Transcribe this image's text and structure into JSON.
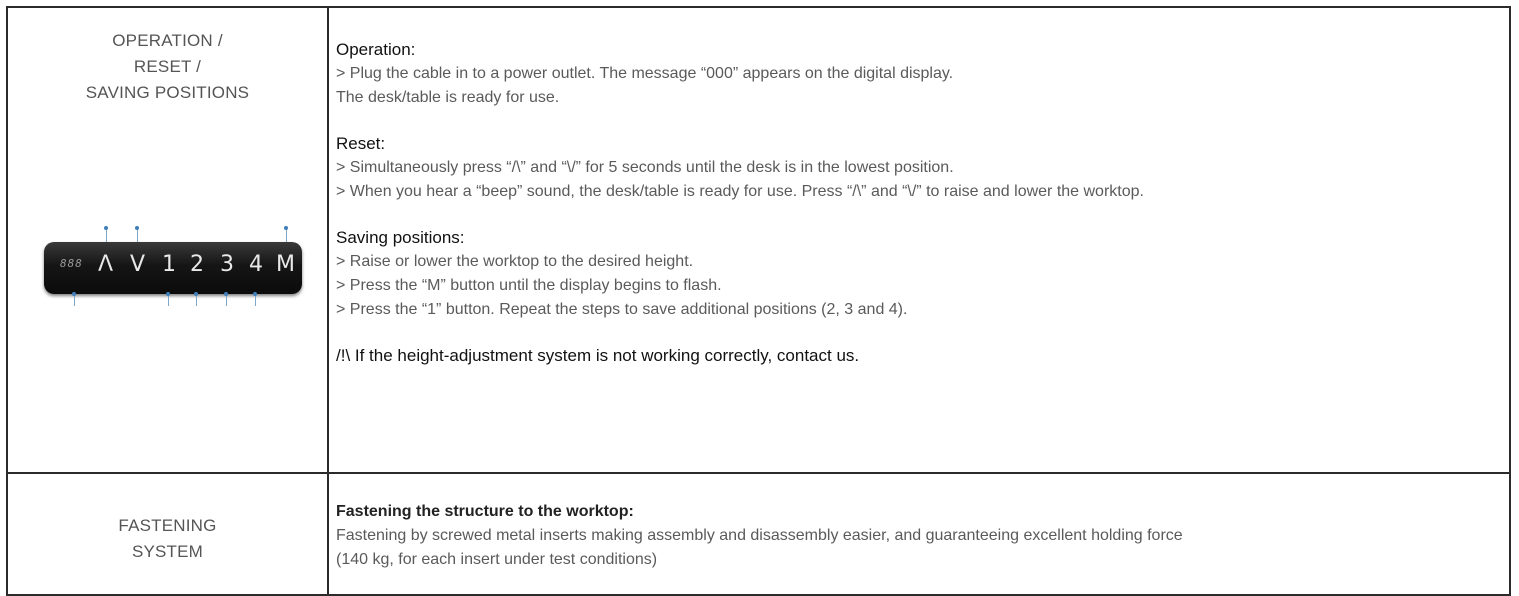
{
  "rows": [
    {
      "label_lines": [
        "OPERATION /",
        "RESET /",
        "SAVING POSITIONS"
      ],
      "sections": [
        {
          "heading": "Operation:",
          "lines": [
            "> Plug the cable in to a power outlet. The message “000” appears on the digital display.",
            "The desk/table is ready for use."
          ]
        },
        {
          "heading": "Reset:",
          "lines": [
            "> Simultaneously press “/\\” and “\\/” for 5 seconds until the desk is in the lowest position.",
            "> When you hear a “beep” sound, the desk/table is ready for use. Press “/\\” and “\\/” to raise and lower the worktop."
          ]
        },
        {
          "heading": "Saving positions:",
          "lines": [
            "> Raise or lower the worktop to the desired height.",
            "> Press the “M” button until the display begins to flash.",
            "> Press the “1” button. Repeat the steps to save additional positions (2, 3 and 4)."
          ]
        }
      ],
      "warning": "/!\\ If the height-adjustment system is not working correctly, contact us.",
      "panel": {
        "display": "888",
        "keys": [
          "Λ",
          "V",
          "1",
          "2",
          "3",
          "4",
          "M"
        ]
      }
    },
    {
      "label_lines": [
        "FASTENING",
        "SYSTEM"
      ],
      "heading": "Fastening the structure to the worktop:",
      "lines": [
        "Fastening by screwed metal inserts making assembly and disassembly easier, and guaranteeing excellent holding force",
        "(140 kg, for each insert under test conditions)"
      ]
    }
  ]
}
